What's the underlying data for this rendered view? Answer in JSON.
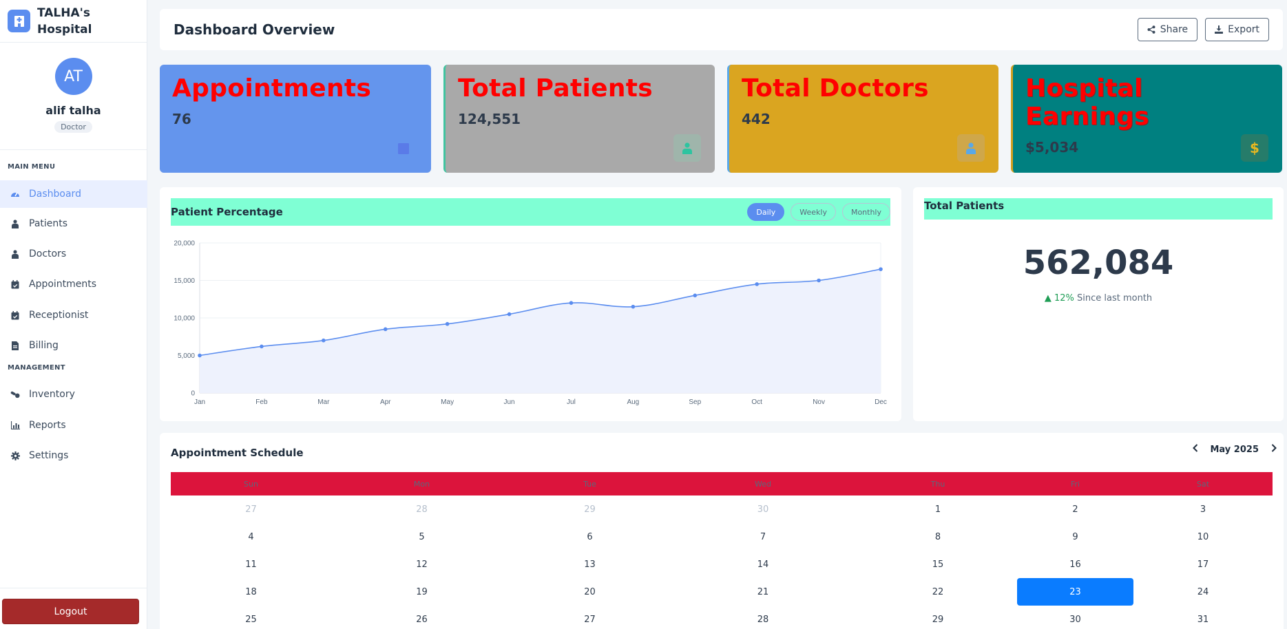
{
  "brand": {
    "name": "TALHA's Hospital",
    "icon": "hospital-icon"
  },
  "profile": {
    "initials": "AT",
    "name": "alif talha",
    "role": "Doctor"
  },
  "menu": {
    "main_heading": "MAIN MENU",
    "main_items": [
      {
        "label": "Dashboard",
        "icon": "gauge-icon",
        "active": true
      },
      {
        "label": "Patients",
        "icon": "hospital-user-icon"
      },
      {
        "label": "Doctors",
        "icon": "user-doctor-icon"
      },
      {
        "label": "Appointments",
        "icon": "calendar-check-icon"
      },
      {
        "label": "Receptionist",
        "icon": "calendar-check-icon"
      },
      {
        "label": "Billing",
        "icon": "file-invoice-icon"
      }
    ],
    "management_heading": "MANAGEMENT",
    "management_items": [
      {
        "label": "Inventory",
        "icon": "pills-icon"
      },
      {
        "label": "Reports",
        "icon": "chart-bar-icon"
      },
      {
        "label": "Settings",
        "icon": "gear-icon"
      }
    ],
    "logout_label": "Logout"
  },
  "header": {
    "title": "Dashboard Overview",
    "share_label": "Share",
    "export_label": "Export"
  },
  "stats": [
    {
      "title": "Appointments",
      "value": "76",
      "bg": "#6495ed",
      "icon": "calendar-icon"
    },
    {
      "title": "Total Patients",
      "value": "124,551",
      "bg": "#a9a9a9",
      "icon": "user-injured-icon"
    },
    {
      "title": "Total Doctors",
      "value": "442",
      "bg": "#daa520",
      "icon": "user-md-icon"
    },
    {
      "title": "Hospital Earnings",
      "value": "$5,034",
      "bg": "#008080",
      "icon": "dollar-icon"
    }
  ],
  "patient_chart": {
    "title": "Patient Percentage",
    "ranges": [
      "Daily",
      "Weekly",
      "Monthly"
    ],
    "active_range": "Daily"
  },
  "chart_data": {
    "type": "area",
    "categories": [
      "Jan",
      "Feb",
      "Mar",
      "Apr",
      "May",
      "Jun",
      "Jul",
      "Aug",
      "Sep",
      "Oct",
      "Nov",
      "Dec"
    ],
    "values": [
      5000,
      6200,
      7000,
      8500,
      9200,
      10500,
      12000,
      11500,
      13000,
      14500,
      15000,
      16500
    ],
    "ylim": [
      0,
      20000
    ],
    "yticks": [
      "0",
      "5,000",
      "10,000",
      "15,000",
      "20,000"
    ],
    "grid": true,
    "color": "#5b8def"
  },
  "total_patients": {
    "title": "Total Patients",
    "value": "562,084",
    "change_pct": "12%",
    "change_text": "Since last month"
  },
  "calendar": {
    "title": "Appointment Schedule",
    "month_label": "May 2025",
    "weekdays": [
      "Sun",
      "Mon",
      "Tue",
      "Wed",
      "Thu",
      "Fri",
      "Sat"
    ],
    "weeks": [
      [
        "27",
        "28",
        "29",
        "30",
        "1",
        "2",
        "3"
      ],
      [
        "4",
        "5",
        "6",
        "7",
        "8",
        "9",
        "10"
      ],
      [
        "11",
        "12",
        "13",
        "14",
        "15",
        "16",
        "17"
      ],
      [
        "18",
        "19",
        "20",
        "21",
        "22",
        "23",
        "24"
      ],
      [
        "25",
        "26",
        "27",
        "28",
        "29",
        "30",
        "31"
      ]
    ],
    "today": "23"
  }
}
